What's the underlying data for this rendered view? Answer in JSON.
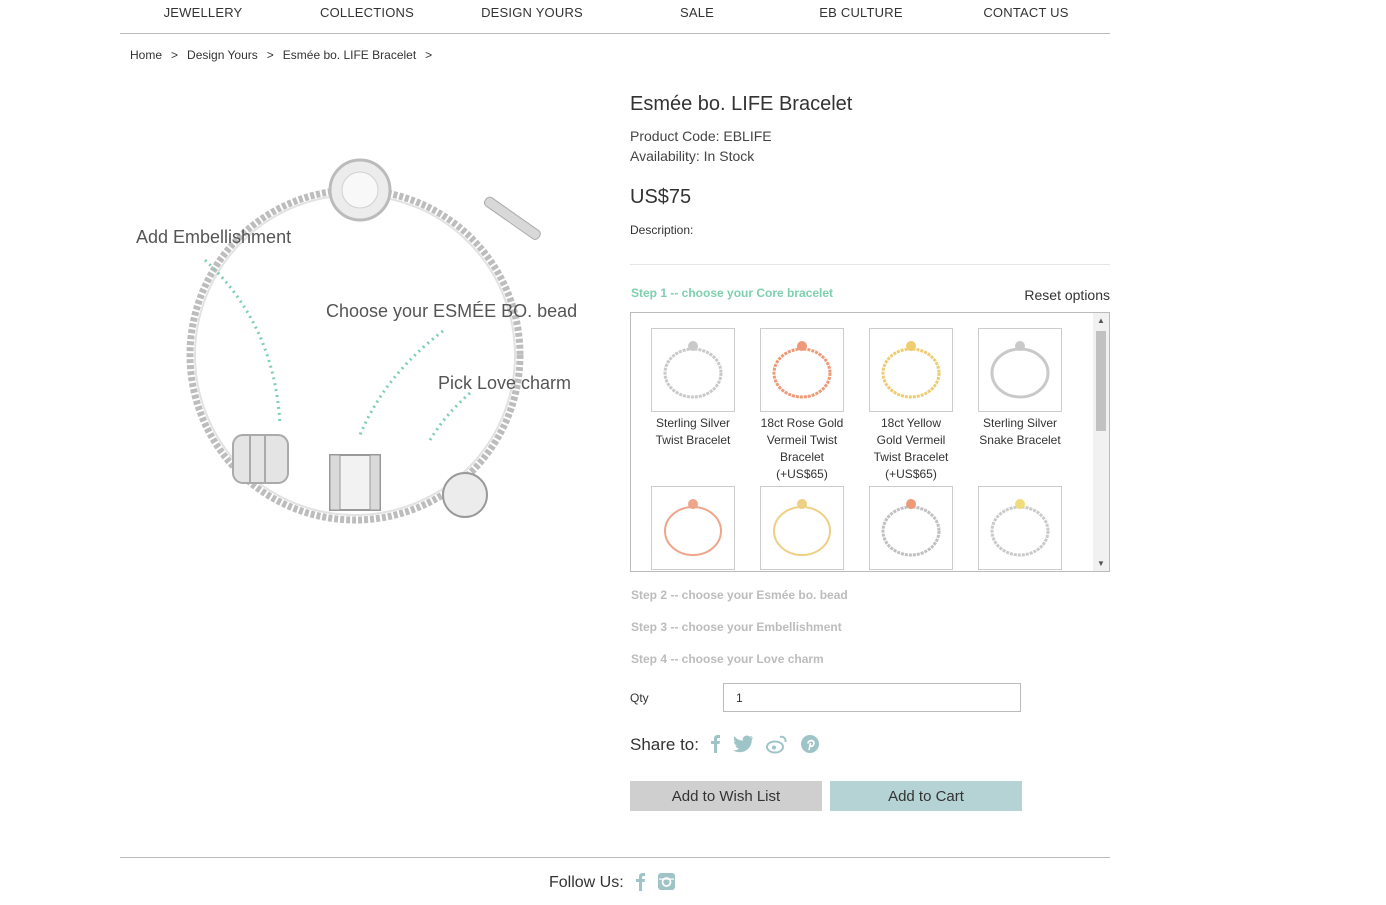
{
  "nav": [
    "JEWELLERY",
    "COLLECTIONS",
    "DESIGN YOURS",
    "SALE",
    "EB CULTURE",
    "CONTACT US"
  ],
  "breadcrumb": [
    "Home",
    "Design Yours",
    "Esmée bo. LIFE Bracelet"
  ],
  "breadcrumb_sep": ">",
  "image_labels": {
    "embellishment": "Add Embellishment",
    "bead": "Choose your ESMÉE BO. bead",
    "charm": "Pick Love charm"
  },
  "product": {
    "title": "Esmée bo. LIFE Bracelet",
    "code": "Product Code: EBLIFE",
    "availability": "Availability: In Stock",
    "price": "US$75",
    "description_label": "Description:"
  },
  "steps": {
    "step1": "Step 1 -- choose your Core bracelet",
    "reset": "Reset options",
    "step2": "Step 2 -- choose your Esmée bo. bead",
    "step3": "Step 3 -- choose your Embellishment",
    "step4": "Step 4 -- choose your Love charm"
  },
  "options": [
    {
      "name": "Sterling Silver Twist Bracelet",
      "lines": [
        "Sterling Silver",
        "Twist Bracelet"
      ],
      "color": "#c9c9c9"
    },
    {
      "name": "18ct Rose Gold Vermeil Twist Bracelet",
      "lines": [
        "18ct Rose Gold",
        "Vermeil Twist",
        "Bracelet",
        "(+US$65)"
      ],
      "color": "#ee9a78"
    },
    {
      "name": "18ct Yellow Gold Vermeil Twist Bracelet",
      "lines": [
        "18ct Yellow",
        "Gold Vermeil",
        "Twist Bracelet",
        "(+US$65)"
      ],
      "color": "#efcc70"
    },
    {
      "name": "Sterling Silver Snake Bracelet",
      "lines": [
        "Sterling Silver",
        "Snake Bracelet"
      ],
      "color": "#c9c9c9"
    },
    {
      "name": "Rose bracelet",
      "lines": [],
      "color": "#eea58a"
    },
    {
      "name": "Gold bracelet",
      "lines": [],
      "color": "#edd083"
    },
    {
      "name": "Silver rose bead bracelet",
      "lines": [],
      "color": "#c0c0c0",
      "bead": "#ee9a78"
    },
    {
      "name": "Silver gold bead bracelet",
      "lines": [],
      "color": "#cacaca",
      "bead": "#f0dd7a"
    }
  ],
  "qty": {
    "label": "Qty",
    "value": "1"
  },
  "share_label": "Share to:",
  "share_icons": [
    "facebook-icon",
    "twitter-icon",
    "weibo-icon",
    "pinterest-icon"
  ],
  "buttons": {
    "wish": "Add to Wish List",
    "cart": "Add to Cart"
  },
  "follow_label": "Follow Us:",
  "colors": {
    "accent": "#7ecfb0",
    "icon": "#9fc4c7",
    "cart_button": "#b5d2d4",
    "wish_button": "#cfcfcf"
  }
}
